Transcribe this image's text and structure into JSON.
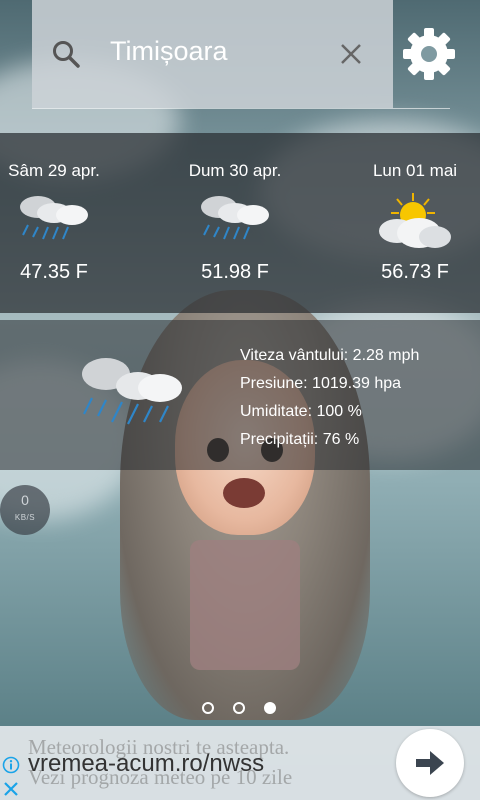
{
  "search": {
    "city": "Timișoara",
    "search_icon": "search-icon",
    "clear_icon": "close-icon"
  },
  "settings_icon": "gear-icon",
  "forecast": [
    {
      "day": "Sâm 29 apr.",
      "temp": "47.35 F",
      "icon": "rain-cloud-icon"
    },
    {
      "day": "Dum 30 apr.",
      "temp": "51.98 F",
      "icon": "rain-cloud-icon"
    },
    {
      "day": "Lun 01 mai",
      "temp": "56.73 F",
      "icon": "partly-sunny-icon"
    }
  ],
  "current": {
    "icon": "rain-cloud-icon",
    "wind": "Viteza vântului: 2.28 mph",
    "pressure": "Presiune: 1019.39 hpa",
    "humidity": "Umiditate: 100 %",
    "precipitation": "Precipitații: 76 %"
  },
  "speed_indicator": {
    "value": "0",
    "unit": "KB/S"
  },
  "pager": {
    "count": 3,
    "active_index": 2
  },
  "ad": {
    "ghost_line1": "Meteorologii nostri te asteapta.",
    "ghost_line2": "Vezi prognoza meteo pe 10 zile",
    "url": "vremea-acum.ro/nwss",
    "info_icon": "info-icon",
    "close_icon": "close-icon",
    "arrow_icon": "arrow-right-icon"
  },
  "colors": {
    "panel": "#282c30",
    "ad_bg": "#e4e8eb",
    "info_blue": "#1aa3e8",
    "text": "#ffffff"
  }
}
